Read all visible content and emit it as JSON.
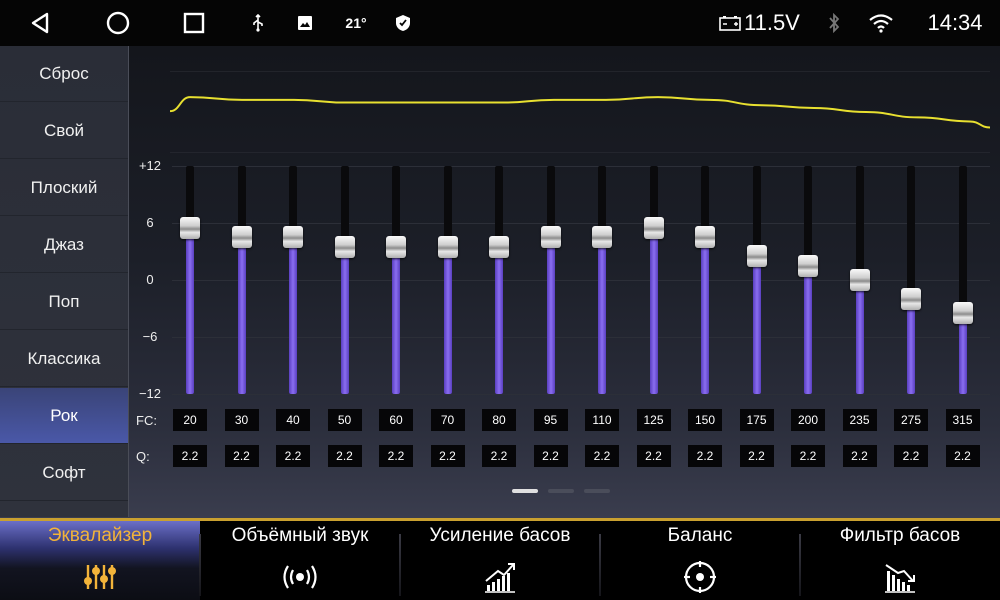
{
  "status_bar": {
    "temperature": "21°",
    "voltage": "11.5V",
    "time": "14:34",
    "icons": [
      "back-triangle-icon",
      "home-circle-icon",
      "recents-square-icon",
      "usb-icon",
      "image-icon",
      "shield-icon",
      "battery-icon",
      "bluetooth-icon",
      "wifi-icon"
    ]
  },
  "presets": {
    "items": [
      "Сброс",
      "Свой",
      "Плоский",
      "Джаз",
      "Поп",
      "Классика",
      "Рок",
      "Софт"
    ],
    "active": "Рок",
    "active_color": "#4a58a8"
  },
  "equalizer": {
    "y_ticks": [
      "+12",
      "6",
      "0",
      "−6",
      "−12"
    ],
    "fc_label": "FC:",
    "q_label": "Q:",
    "frequencies": [
      "20",
      "30",
      "40",
      "50",
      "60",
      "70",
      "80",
      "95",
      "110",
      "125",
      "150",
      "175",
      "200",
      "235",
      "275",
      "315"
    ],
    "q_values": [
      "2.2",
      "2.2",
      "2.2",
      "2.2",
      "2.2",
      "2.2",
      "2.2",
      "2.2",
      "2.2",
      "2.2",
      "2.2",
      "2.2",
      "2.2",
      "2.2",
      "2.2",
      "2.2"
    ],
    "gains_db": [
      5.5,
      4.5,
      4.5,
      3.5,
      3.5,
      3.5,
      3.5,
      4.5,
      4.5,
      5.5,
      4.5,
      2.5,
      1.5,
      0,
      -2,
      -3.5
    ],
    "range_db": [
      -12,
      12
    ],
    "slider_fill_color": "#6a50d8",
    "curve_color": "#e8e030"
  },
  "pager": {
    "count": 3,
    "active_index": 0
  },
  "tabs": {
    "items": [
      {
        "label": "Эквалайзер",
        "icon": "equalizer-sliders-icon"
      },
      {
        "label": "Объёмный звук",
        "icon": "surround-sound-icon"
      },
      {
        "label": "Усиление басов",
        "icon": "bass-boost-chart-icon"
      },
      {
        "label": "Баланс",
        "icon": "balance-target-icon"
      },
      {
        "label": "Фильтр басов",
        "icon": "bass-filter-chart-icon"
      }
    ],
    "active_index": 0,
    "active_color": "#f2b33a",
    "accent_line_color": "#c9a030"
  }
}
